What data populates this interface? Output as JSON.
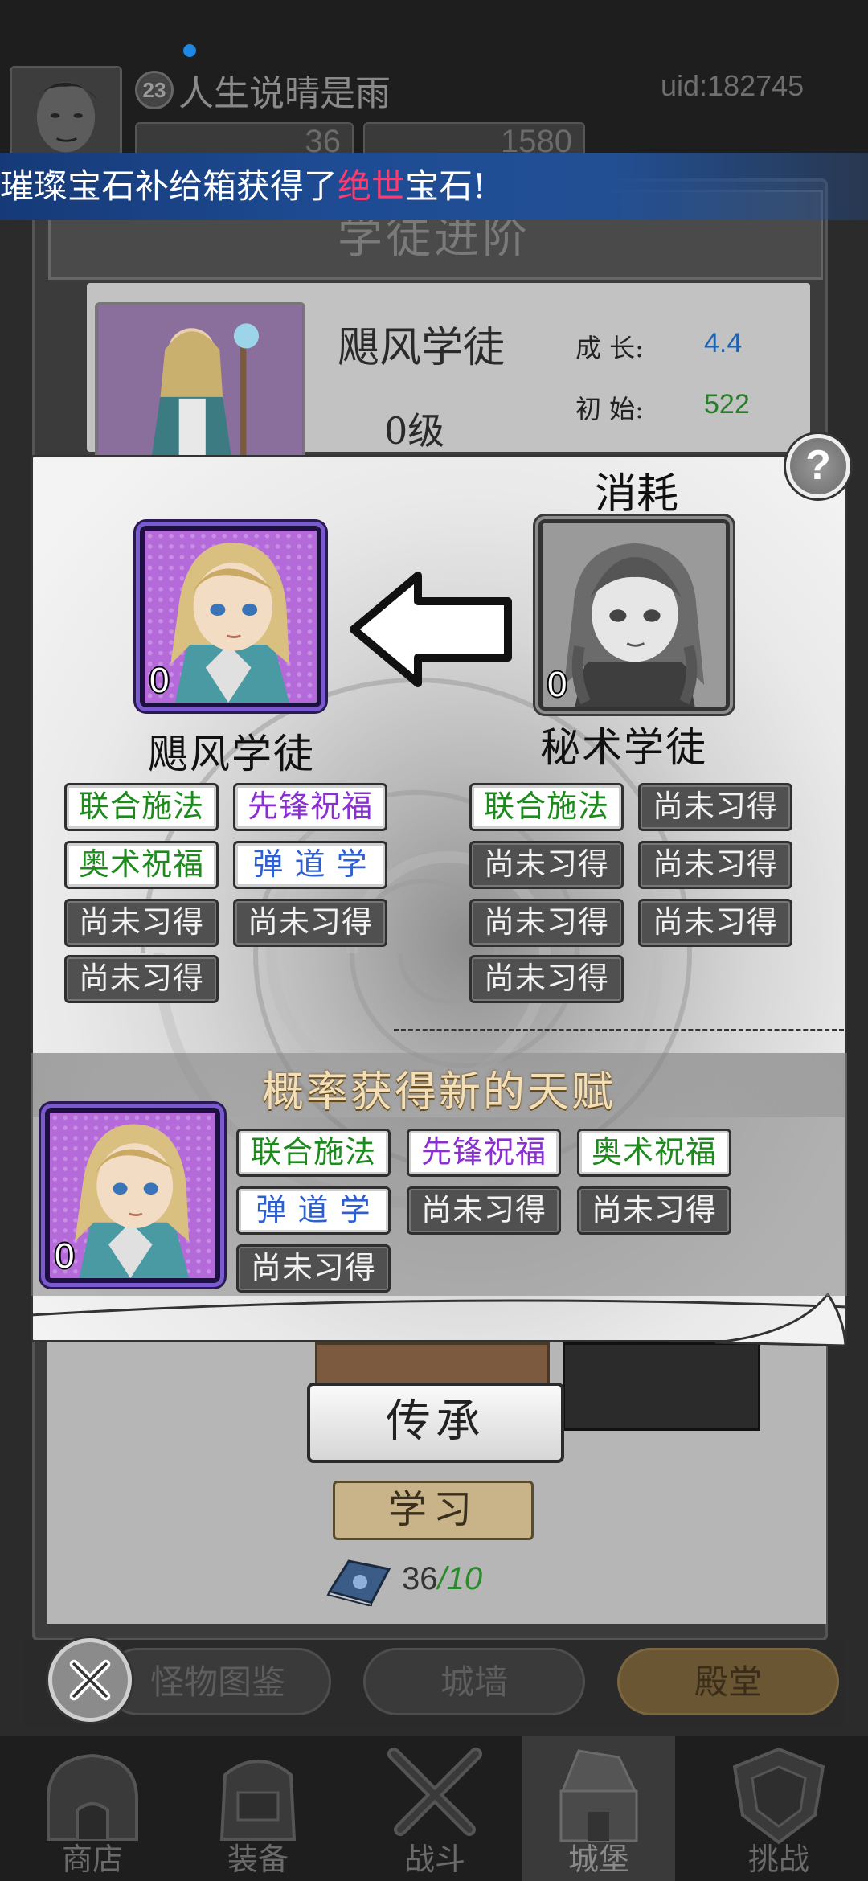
{
  "header": {
    "player_level": "23",
    "player_name": "人生说晴是雨",
    "uid": "uid:182745",
    "resource_1": "36",
    "resource_2": "1580"
  },
  "banner": {
    "prefix": "璀璨宝石补给箱获得了",
    "highlight": "绝世",
    "suffix": "宝石!"
  },
  "background_panel": {
    "title": "学徒进阶",
    "apprentice_name": "飓风学徒",
    "level": "0级",
    "growth_label": "成 长:",
    "growth_value": "4.4",
    "initial_label": "初 始:",
    "initial_value": "522",
    "inherit_button": "传承",
    "learn_button": "学习",
    "book_count": "36",
    "book_required": "/10"
  },
  "modal": {
    "cost_label": "消耗",
    "help_icon": "question-mark-icon",
    "target": {
      "name": "飓风学徒",
      "count": "0",
      "talents": [
        {
          "label": "联合施法",
          "style": "green"
        },
        {
          "label": "先锋祝福",
          "style": "purple"
        },
        {
          "label": "奥术祝福",
          "style": "green"
        },
        {
          "label": "弹 道 学",
          "style": "blue"
        },
        {
          "label": "尚未习得",
          "style": "grey"
        },
        {
          "label": "尚未习得",
          "style": "grey"
        },
        {
          "label": "尚未习得",
          "style": "grey"
        }
      ]
    },
    "consumed": {
      "name": "秘术学徒",
      "count": "0",
      "talents": [
        {
          "label": "联合施法",
          "style": "green"
        },
        {
          "label": "尚未习得",
          "style": "grey"
        },
        {
          "label": "尚未习得",
          "style": "grey"
        },
        {
          "label": "尚未习得",
          "style": "grey"
        },
        {
          "label": "尚未习得",
          "style": "grey"
        },
        {
          "label": "尚未习得",
          "style": "grey"
        },
        {
          "label": "尚未习得",
          "style": "grey"
        }
      ]
    },
    "result": {
      "title": "概率获得新的天赋",
      "count": "0",
      "talents": [
        {
          "label": "联合施法",
          "style": "green"
        },
        {
          "label": "先锋祝福",
          "style": "purple"
        },
        {
          "label": "奥术祝福",
          "style": "green"
        },
        {
          "label": "弹 道 学",
          "style": "blue"
        },
        {
          "label": "尚未习得",
          "style": "grey"
        },
        {
          "label": "尚未习得",
          "style": "grey"
        },
        {
          "label": "尚未习得",
          "style": "grey"
        }
      ]
    }
  },
  "subtabs": [
    "怪物图鉴",
    "城墙",
    "殿堂"
  ],
  "bottom_nav": [
    "商店",
    "装备",
    "战斗",
    "城堡",
    "挑战"
  ],
  "colors": {
    "talent_green": "#1e8a1e",
    "talent_purple": "#8a2fd0",
    "talent_blue": "#2d5fd0",
    "talent_locked_bg": "#505050",
    "banner_blue": "#1e4c94",
    "banner_highlight": "#ff3b6e",
    "rare_frame": "#7b5ad0"
  }
}
